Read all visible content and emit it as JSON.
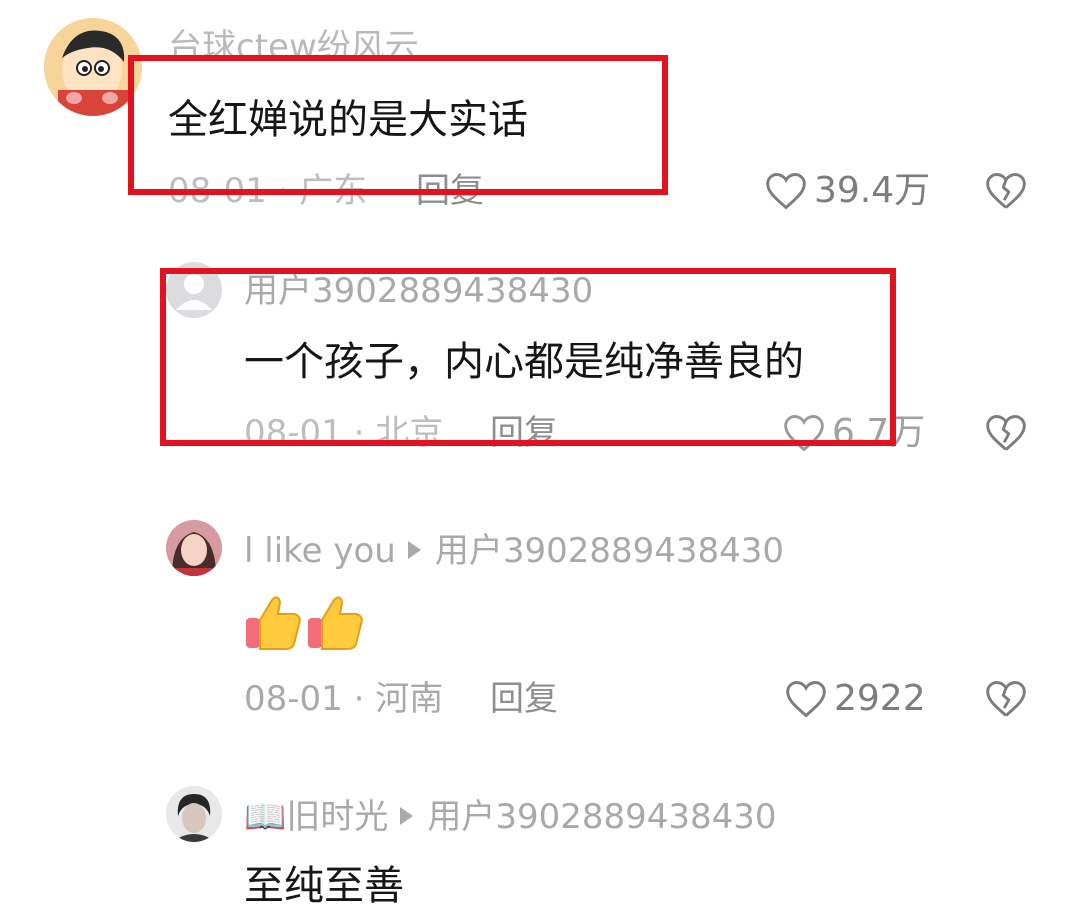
{
  "comments": [
    {
      "username": "台球ctew纷风云",
      "text": "全红婵说的是大实话",
      "date_location": "08-01 · 广东",
      "reply_label": "回复",
      "likes": "39.4万"
    },
    {
      "username": "用户3902889438430",
      "text": "一个孩子，内心都是纯净善良的",
      "date_location": "08-01 · 北京",
      "reply_label": "回复",
      "likes": "6.7万"
    },
    {
      "username": "l like you",
      "reply_to": "用户3902889438430",
      "text_emoji": "👍👍",
      "date_location": "08-01 · 河南",
      "reply_label": "回复",
      "likes": "2922"
    },
    {
      "username": "📖旧时光",
      "reply_to": "用户3902889438430",
      "text": "至纯至善"
    }
  ],
  "icons": {
    "like": "heart-outline-icon",
    "dislike": "broken-heart-icon",
    "reply_arrow": "play-triangle-icon"
  },
  "colors": {
    "highlight_box": "#e4121f",
    "muted_text": "#a9a9a9",
    "body_text": "#161616"
  }
}
